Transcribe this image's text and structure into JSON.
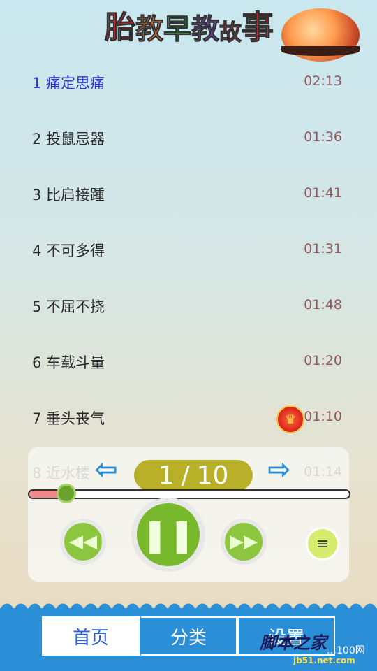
{
  "header": {
    "title_chars": [
      "胎",
      "教",
      "早",
      "教",
      "故",
      "事"
    ],
    "title_colors": [
      "#e6262e",
      "#ff7a1a",
      "#3bb54a",
      "#7a3fd1",
      "#e6262e",
      "#e6262e"
    ]
  },
  "stories": [
    {
      "label": "1 痛定思痛",
      "duration": "02:13",
      "active": true
    },
    {
      "label": "2 投鼠忌器",
      "duration": "01:36"
    },
    {
      "label": "3 比肩接踵",
      "duration": "01:41"
    },
    {
      "label": "4 不可多得",
      "duration": "01:31"
    },
    {
      "label": "5 不屈不挠",
      "duration": "01:48"
    },
    {
      "label": "6 车载斗量",
      "duration": "01:20"
    },
    {
      "label": "7 垂头丧气",
      "duration": "01:10",
      "badge": "crown-icon"
    }
  ],
  "peek_row": {
    "label": "8 近水楼",
    "duration": "01:14"
  },
  "player": {
    "page_current": "1",
    "page_sep": "/",
    "page_total": "10",
    "prev_icon": "rewind-icon",
    "play_icon": "pause-icon",
    "next_icon": "fast-forward-icon",
    "list_icon": "menu-icon",
    "progress_fraction": 0.12
  },
  "tabs": {
    "home": "首页",
    "category": "分类",
    "settings": "设置"
  },
  "watermark": {
    "brand": "脚本之家",
    "site": "…100网",
    "url": "jb51.net.com"
  },
  "colors": {
    "accent": "#2b8fd8",
    "active_title": "#2c38d8",
    "green": "#77b82c"
  }
}
